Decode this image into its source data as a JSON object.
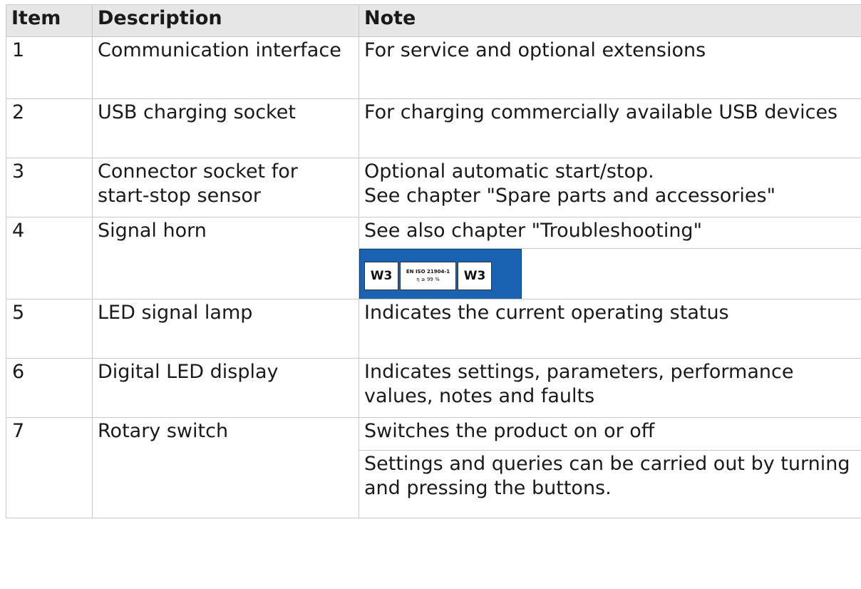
{
  "table": {
    "headers": {
      "item": "Item",
      "description": "Description",
      "note": "Note"
    },
    "rows": [
      {
        "item": "1",
        "description": "Communication interface",
        "notes": [
          "For service and optional extensions"
        ]
      },
      {
        "item": "2",
        "description": "USB charging socket",
        "notes": [
          "For charging commercially available USB devices"
        ]
      },
      {
        "item": "3",
        "description": "Connector socket for start-stop sensor",
        "notes": [
          "Optional automatic start/stop.",
          "See chapter \"Spare parts and accessories\""
        ]
      },
      {
        "item": "4",
        "description": "Signal horn",
        "notes": [
          "See also chapter \"Troubleshooting\""
        ],
        "marking": {
          "left": "W3",
          "standard": "EN ISO 21904-1",
          "efficiency": "η ≥ 99 %",
          "right": "W3",
          "background_color": "#1a63b3"
        }
      },
      {
        "item": "5",
        "description": "LED signal lamp",
        "notes": [
          "Indicates the current operating status"
        ]
      },
      {
        "item": "6",
        "description": "Digital LED display",
        "notes": [
          "Indicates settings, parameters, performance values, notes and faults"
        ]
      },
      {
        "item": "7",
        "description": "Rotary switch",
        "notes": [
          "Switches the product on or off",
          "Settings and queries can be carried out by turning and pressing the buttons."
        ]
      }
    ]
  }
}
